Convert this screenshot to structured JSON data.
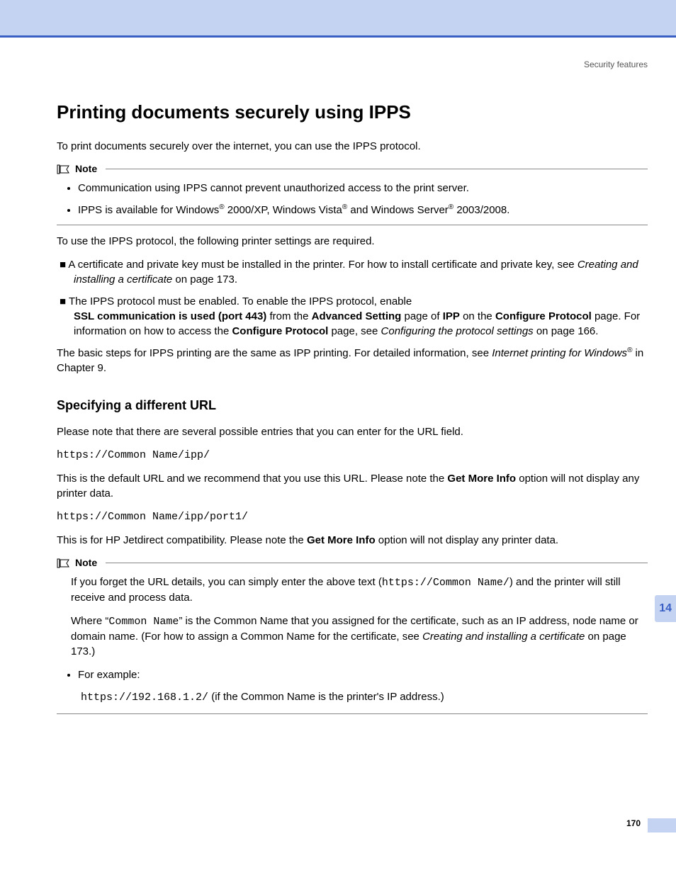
{
  "header": {
    "section": "Security features"
  },
  "title": "Printing documents securely using IPPS",
  "intro": "To print documents securely over the internet, you can use the IPPS protocol.",
  "note1": {
    "label": "Note",
    "items": [
      "Communication using IPPS cannot prevent unauthorized access to the print server."
    ],
    "item2_pre": "IPPS is available for Windows",
    "item2_mid1": " 2000/XP, Windows Vista",
    "item2_mid2": " and Windows Server",
    "item2_end": " 2003/2008."
  },
  "para2": "To use the IPPS protocol, the following printer settings are required.",
  "bullets": {
    "b1_pre": "A certificate and private key must be installed in the printer. For how to install certificate and private key, see ",
    "b1_ital": "Creating and installing a certificate",
    "b1_post": " on page 173.",
    "b2_line1": "The IPPS protocol must be enabled. To enable the IPPS protocol, enable ",
    "b2_bold1": "SSL communication is used (port 443)",
    "b2_mid1": " from the ",
    "b2_bold2": "Advanced Setting",
    "b2_mid2": " page of ",
    "b2_bold3": "IPP",
    "b2_mid3": " on the ",
    "b2_bold4": "Configure Protocol",
    "b2_mid4": " page. For information on how to access the ",
    "b2_bold5": "Configure Protocol",
    "b2_mid5": " page, see ",
    "b2_ital": "Configuring the protocol settings",
    "b2_post": " on page 166."
  },
  "para3_pre": "The basic steps for IPPS printing are the same as IPP printing. For detailed information, see ",
  "para3_ital": "Internet printing for Windows",
  "para3_post": " in Chapter 9.",
  "h2": "Specifying a different URL",
  "url_intro": "Please note that there are several possible entries that you can enter for the URL field.",
  "url1": "https://Common Name/ipp/",
  "url1_desc_pre": "This is the default URL and we recommend that you use this URL. Please note the ",
  "url1_desc_bold": "Get More Info",
  "url1_desc_post": " option will not display any printer data.",
  "url2": "https://Common Name/ipp/port1/",
  "url2_desc_pre": "This is for HP Jetdirect compatibility. Please note the ",
  "url2_desc_bold": "Get More Info",
  "url2_desc_post": " option will not display any printer data.",
  "note2": {
    "label": "Note",
    "p1_pre": "If you forget the URL details, you can simply enter the above text (",
    "p1_code": "https://Common Name/",
    "p1_post": ") and the printer will still receive and process data.",
    "p2_pre": "Where “",
    "p2_code": "Common Name",
    "p2_mid": "” is the Common Name that you assigned for the certificate, such as an IP address, node name or domain name. (For how to assign a Common Name for the certificate, see ",
    "p2_ital": "Creating and installing a certificate",
    "p2_post": " on page 173.)",
    "ex_label": "For example:",
    "ex_code": "https://192.168.1.2/",
    "ex_post": " (if the Common Name is the printer's IP address.)"
  },
  "chapter_tab": "14",
  "page_number": "170"
}
